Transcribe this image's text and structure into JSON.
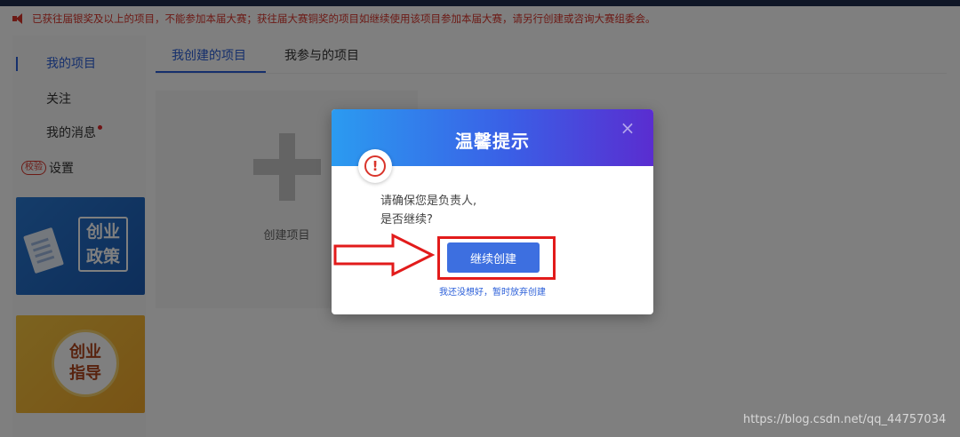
{
  "notice": {
    "text": "已获往届银奖及以上的项目，不能参加本届大赛；获往届大赛铜奖的项目如继续使用该项目参加本届大赛，请另行创建或咨询大赛组委会。",
    "icon": "speaker-icon"
  },
  "sidebar": {
    "items": [
      {
        "label": "我的项目",
        "active": true
      },
      {
        "label": "关注"
      },
      {
        "label": "我的消息",
        "has_dot": true
      },
      {
        "label": "设置",
        "badge": "校验"
      }
    ],
    "banners": [
      {
        "label_line1": "创业",
        "label_line2": "政策"
      },
      {
        "label_line1": "创业",
        "label_line2": "指导"
      }
    ]
  },
  "tabs": [
    {
      "label": "我创建的项目",
      "active": true
    },
    {
      "label": "我参与的项目"
    }
  ],
  "create_card": {
    "label": "创建项目"
  },
  "modal": {
    "title": "温馨提示",
    "message_line1": "请确保您是负责人,",
    "message_line2": "是否继续?",
    "confirm_label": "继续创建",
    "cancel_label": "我还没想好，暂时放弃创建",
    "close_symbol": "×",
    "alert_symbol": "!"
  },
  "watermark": "https://blog.csdn.net/qq_44757034",
  "colors": {
    "accent": "#2b5fd9",
    "notice": "#d9342b",
    "annotation": "#e21b1b"
  }
}
